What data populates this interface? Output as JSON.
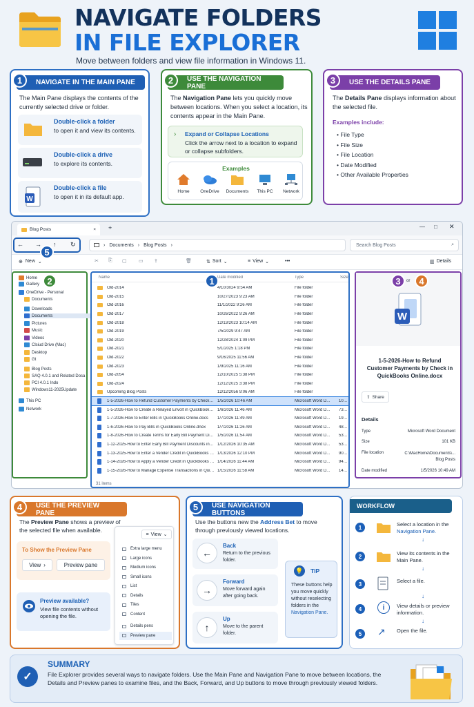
{
  "header": {
    "title_line1": "NAVIGATE FOLDERS",
    "title_line2": "IN FILE EXPLORER",
    "subtitle": "Move between folders and view file information in Windows 11."
  },
  "colors": {
    "blue": "#2d6fc4",
    "green": "#3d8a3a",
    "purple": "#7b3fa8",
    "orange": "#d9772b",
    "navy": "#13325c"
  },
  "section1": {
    "num": "1",
    "title": "NAVIGATE IN THE MAIN PANE",
    "desc": "The Main Pane displays the contents of the currently selected drive or folder.",
    "items": [
      {
        "icon": "folder-icon",
        "strong": "Double-click a folder",
        "rest": "to open it and view its contents."
      },
      {
        "icon": "drive-icon",
        "strong": "Double-click a drive",
        "rest": "to explore its contents."
      },
      {
        "icon": "word-file-icon",
        "strong": "Double-click a file",
        "rest": "to open it in its default app."
      }
    ]
  },
  "section2": {
    "num": "2",
    "title": "USE THE NAVIGATION PANE",
    "desc_strong": "Navigation Pane",
    "desc_pre": "The ",
    "desc_post": " lets you quickly move between locations. When you select a location, its contents appear in the Main Pane.",
    "expand_title": "Expand or Collapse Locations",
    "expand_text": "Click the arrow next to a location to expand or collapse subfolders.",
    "examples_title": "Examples",
    "examples": [
      "Home",
      "OneDrive",
      "Documents",
      "This PC",
      "Network"
    ]
  },
  "section3": {
    "num": "3",
    "title": "USE THE DETAILS PANE",
    "desc_pre": "The ",
    "desc_strong": "Details Pane",
    "desc_post": " displays information about the selected file.",
    "examples_title": "Examples include:",
    "items": [
      "File Type",
      "File Size",
      "File Location",
      "Date Modified",
      "Other Available Properties"
    ]
  },
  "explorer": {
    "tab_label": "Blog Posts",
    "tab_close": "×",
    "tab_new": "+",
    "breadcrumb": [
      "Documents",
      "Blog Posts"
    ],
    "search_placeholder": "Search Blog Posts",
    "new_label": "New",
    "sort_label": "Sort",
    "view_label": "View",
    "more_label": "•••",
    "details_label": "Details",
    "columns": {
      "name": "Name",
      "date": "Date modified",
      "type": "Type",
      "size": "Size"
    },
    "nav_items": [
      {
        "label": "Home",
        "color": "#e07b2c",
        "indent": 0
      },
      {
        "label": "Gallery",
        "color": "#2f8ad3",
        "indent": 0
      },
      {
        "label": "OneDrive - Personal",
        "color": "#2f7ed8",
        "indent": 0
      },
      {
        "label": "Documents",
        "color": "#f4b73c",
        "indent": 1
      },
      {
        "label": "Downloads",
        "color": "#2f8ad3",
        "indent": 1
      },
      {
        "label": "Documents",
        "color": "#2f6ecf",
        "indent": 1
      },
      {
        "label": "Pictures",
        "color": "#2f8ad3",
        "indent": 1
      },
      {
        "label": "Music",
        "color": "#d24b4b",
        "indent": 1
      },
      {
        "label": "Videos",
        "color": "#7b3fa8",
        "indent": 1
      },
      {
        "label": "Clsiud Drive (Mac)",
        "color": "#2f8ad3",
        "indent": 1
      },
      {
        "label": "Desktop",
        "color": "#f4b73c",
        "indent": 1
      },
      {
        "label": "Gt",
        "color": "#f4b73c",
        "indent": 1
      },
      {
        "label": "Blog Posts",
        "color": "#f4b73c",
        "indent": 1
      },
      {
        "label": "SAQ 4.0.1 and Related Dosa",
        "color": "#f4b73c",
        "indent": 1
      },
      {
        "label": "PCI 4.0.1 Indo",
        "color": "#f4b73c",
        "indent": 1
      },
      {
        "label": "Windows11-2025Update",
        "color": "#f4b73c",
        "indent": 1
      },
      {
        "label": "This PC",
        "color": "#2f8ad3",
        "indent": 0
      },
      {
        "label": "Network",
        "color": "#2f8ad3",
        "indent": 0
      }
    ],
    "files": [
      {
        "name": "Old-2014",
        "date": "4/10/3024 9:54 AM",
        "type": "File folder",
        "size": "",
        "kind": "folder"
      },
      {
        "name": "Old-2015",
        "date": "10/27/2023 9:23 AM",
        "type": "File folder",
        "size": "",
        "kind": "folder"
      },
      {
        "name": "Old-2016",
        "date": "11/1/2022 9:26 AM",
        "type": "File folder",
        "size": "",
        "kind": "folder"
      },
      {
        "name": "Old-2017",
        "date": "10/26/2022 9:26 AM",
        "type": "File folder",
        "size": "",
        "kind": "folder"
      },
      {
        "name": "Old-2018",
        "date": "12/13/2023 10:14 AM",
        "type": "File folder",
        "size": "",
        "kind": "folder"
      },
      {
        "name": "Old-2019",
        "date": "7/5/2029 9:47 AM",
        "type": "File folder",
        "size": "",
        "kind": "folder"
      },
      {
        "name": "Old-2020",
        "date": "12/28/2024 1:09 PM",
        "type": "File folder",
        "size": "",
        "kind": "folder"
      },
      {
        "name": "Old-2021",
        "date": "5/1/2025 1:18 PM",
        "type": "File folder",
        "size": "",
        "kind": "folder"
      },
      {
        "name": "Old-2022",
        "date": "9/16/2025 11:56 AM",
        "type": "File folder",
        "size": "",
        "kind": "folder"
      },
      {
        "name": "Old-2023",
        "date": "1/9/2025 11:16 AM",
        "type": "File folder",
        "size": "",
        "kind": "folder"
      },
      {
        "name": "Old-2054",
        "date": "12/10/2025 5:38 PM",
        "type": "File folder",
        "size": "",
        "kind": "folder"
      },
      {
        "name": "Old-2024",
        "date": "12/12/2025 3:38 PM",
        "type": "File folder",
        "size": "",
        "kind": "folder"
      },
      {
        "name": "Upcoming Blog Posts",
        "date": "12/12/2056 9:06 AM",
        "type": "File folder",
        "size": "",
        "kind": "folder"
      },
      {
        "name": "1-5-2026-How to Refund Customer Payments by Check in Qui...",
        "date": "1/5/2026 10:46 AM",
        "type": "Microsoft Word D...",
        "size": "101 KB",
        "kind": "doc",
        "selected": true
      },
      {
        "name": "1-5-2026-How to Create a Relayed Envolt in QuickBooks Onlio...",
        "date": "1/6/2026 11:46 AM",
        "type": "Microsoft Word D...",
        "size": "73 KB",
        "kind": "doc"
      },
      {
        "name": "1-7-2026-How to Enter Bills in QuickBooks Online.docs",
        "date": "1/7/2026 11:49 AM",
        "type": "Microsoft Word D...",
        "size": "19 KB",
        "kind": "doc"
      },
      {
        "name": "1-6-2026-How to Pay Bills in QuickBooks Online.dnex",
        "date": "1/7/2026 11:26 AM",
        "type": "Microsoft Word D...",
        "size": "48 KB",
        "kind": "doc"
      },
      {
        "name": "1-8-2026-How to Create Terms for Early Bill Payment Discount...",
        "date": "1/5/2026 11:54 AM",
        "type": "Microsoft Word D...",
        "size": "53 KB",
        "kind": "doc"
      },
      {
        "name": "1-12-2025-How to Enter Early Bill Payment Discounts in Quick...",
        "date": "1/12/2026 10:35 AM",
        "type": "Microsoft Word D...",
        "size": "53 KB",
        "kind": "doc"
      },
      {
        "name": "1-13-2025-How to Enter a Vender Credit in QuickBooks Online...",
        "date": "1/13/2026 12:10 PM",
        "type": "Microsoft Word D...",
        "size": "90 KB",
        "kind": "doc"
      },
      {
        "name": "1-14-2026-How to Apply a Vender Credit in QuickBooks Online...",
        "date": "1/14/2026 11:44 AM",
        "type": "Microsoft Word D...",
        "size": "94 KB",
        "kind": "doc"
      },
      {
        "name": "1-15-2026-How to Manage Expense Transactions in QuickBook...",
        "date": "1/15/2026 11:58 AM",
        "type": "Microsoft Word D...",
        "size": "14 KB",
        "kind": "doc"
      }
    ],
    "status": "31 items",
    "details": {
      "title": "1-5-2026-How to Refund Customer Payments by Check in QuickBooks Online.docx",
      "share_label": "Share",
      "heading": "Details",
      "rows": [
        {
          "k": "Type",
          "v": "Microsoft Word Document"
        },
        {
          "k": "Size",
          "v": "101 KB"
        },
        {
          "k": "File location",
          "v": "C:\\MacHome\\Documents\\... Blog Posts"
        },
        {
          "k": "Date modified",
          "v": "1/5/2026 10:49 AM"
        }
      ]
    },
    "markers": {
      "m1": "1",
      "m2": "2",
      "m3": "3",
      "or": "or",
      "m4": "4",
      "m5": "5"
    }
  },
  "section4": {
    "num": "4",
    "title": "USE THE PREVIEW PANE",
    "desc_pre": "The ",
    "desc_strong": "Preview Pane",
    "desc_post": " shows a preview of the selected file when available.",
    "show_title": "To Show the Preview Pane",
    "view_btn": "View",
    "preview_btn": "Preview pane",
    "available_title": "Preview available?",
    "available_text": "View file contents without opening the file.",
    "menu_btn": "View",
    "menu_items": [
      "Extra large menu",
      "Large icons",
      "Medium icons",
      "Small icons",
      "List",
      "Details",
      "Tiles",
      "Content",
      "Details pens",
      "Preview pane"
    ]
  },
  "section5": {
    "num": "5",
    "title": "USE NAVIGATION BUTTONS",
    "desc_pre": "Use the buttons new the ",
    "desc_strong": "Address Bet",
    "desc_post": " to move through previously viewed locations.",
    "buttons": [
      {
        "icon": "back-arrow-icon",
        "title": "Back",
        "text": "Return to the previous folder."
      },
      {
        "icon": "forward-arrow-icon",
        "title": "Forward",
        "text": "Move forward again after going back."
      },
      {
        "icon": "up-arrow-icon",
        "title": "Up",
        "text": "Move to the parent folder."
      }
    ],
    "tip_title": "TIP",
    "tip_text": "These buttons help you move quickly without reselecting folders in the",
    "tip_strong": "Navigation Pane."
  },
  "workflow": {
    "title": "WORKFLOW",
    "steps": [
      {
        "num": "1",
        "text": "Select a location in the",
        "strong": "Navigation Pane."
      },
      {
        "num": "2",
        "text": "View its contents in the Main Pane.",
        "strong": ""
      },
      {
        "num": "3",
        "text": "Select a file.",
        "strong": ""
      },
      {
        "num": "4",
        "text": "View details or preview information.",
        "strong": ""
      },
      {
        "num": "5",
        "text": "Open the file.",
        "strong": ""
      }
    ]
  },
  "summary": {
    "title": "SUMMARY",
    "text": "File Explorer provides several ways to navigate folders. Use the Main Pane and Navigation Pane to move between locations, the Details and Preview panes to examine files, and the Back, Forward, and Up buttons to move through previously viewed folders."
  }
}
